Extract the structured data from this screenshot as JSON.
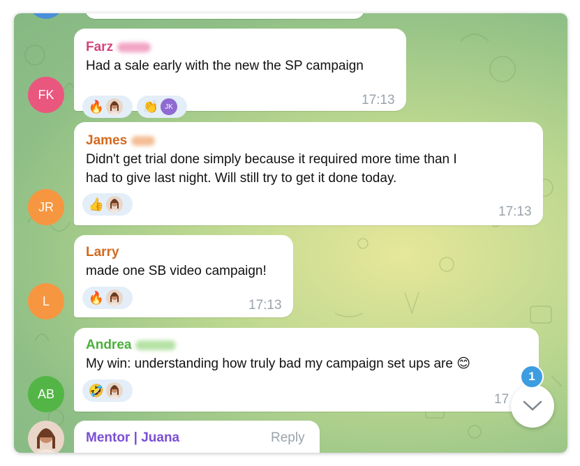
{
  "colors": {
    "fk_avatar": "#e9577e",
    "jr_avatar": "#f79640",
    "l_avatar": "#f79640",
    "ab_avatar": "#53b546",
    "badge": "#3d9de0"
  },
  "messages": [
    {
      "avatar": "FK",
      "sender": "Farz",
      "sender_color": "#d2467b",
      "text": [
        "Had a sale early  with the new the SP campaign"
      ],
      "time": "17:13",
      "reactions": [
        {
          "emoji": "🔥",
          "reactor": "photo"
        },
        {
          "emoji": "👏",
          "reactor": "JK"
        }
      ]
    },
    {
      "avatar": "JR",
      "sender": "James",
      "sender_color": "#d2691e",
      "text": [
        "Didn't get trial done simply because it required more time than I",
        "had to give last night.  Will still try to get it done today."
      ],
      "time": "17:13",
      "reactions": [
        {
          "emoji": "👍",
          "reactor": "photo"
        }
      ]
    },
    {
      "avatar": "L",
      "sender": "Larry",
      "sender_color": "#d2691e",
      "text": [
        "made one SB video campaign!"
      ],
      "time": "17:13",
      "reactions": [
        {
          "emoji": "🔥",
          "reactor": "photo"
        }
      ]
    },
    {
      "avatar": "AB",
      "sender": "Andrea",
      "sender_color": "#4caf3c",
      "text": [
        "My win:  understanding how truly bad my campaign set ups are 😊"
      ],
      "time": "17",
      "reactions": [
        {
          "emoji": "🤣",
          "reactor": "photo"
        }
      ]
    },
    {
      "avatar": "photo",
      "sender": "Mentor | Juana",
      "sender_color": "#7a4fd4",
      "reply_label": "Reply"
    }
  ],
  "unread_badge": "1",
  "scroll_down_icon": "chevron-down-icon"
}
